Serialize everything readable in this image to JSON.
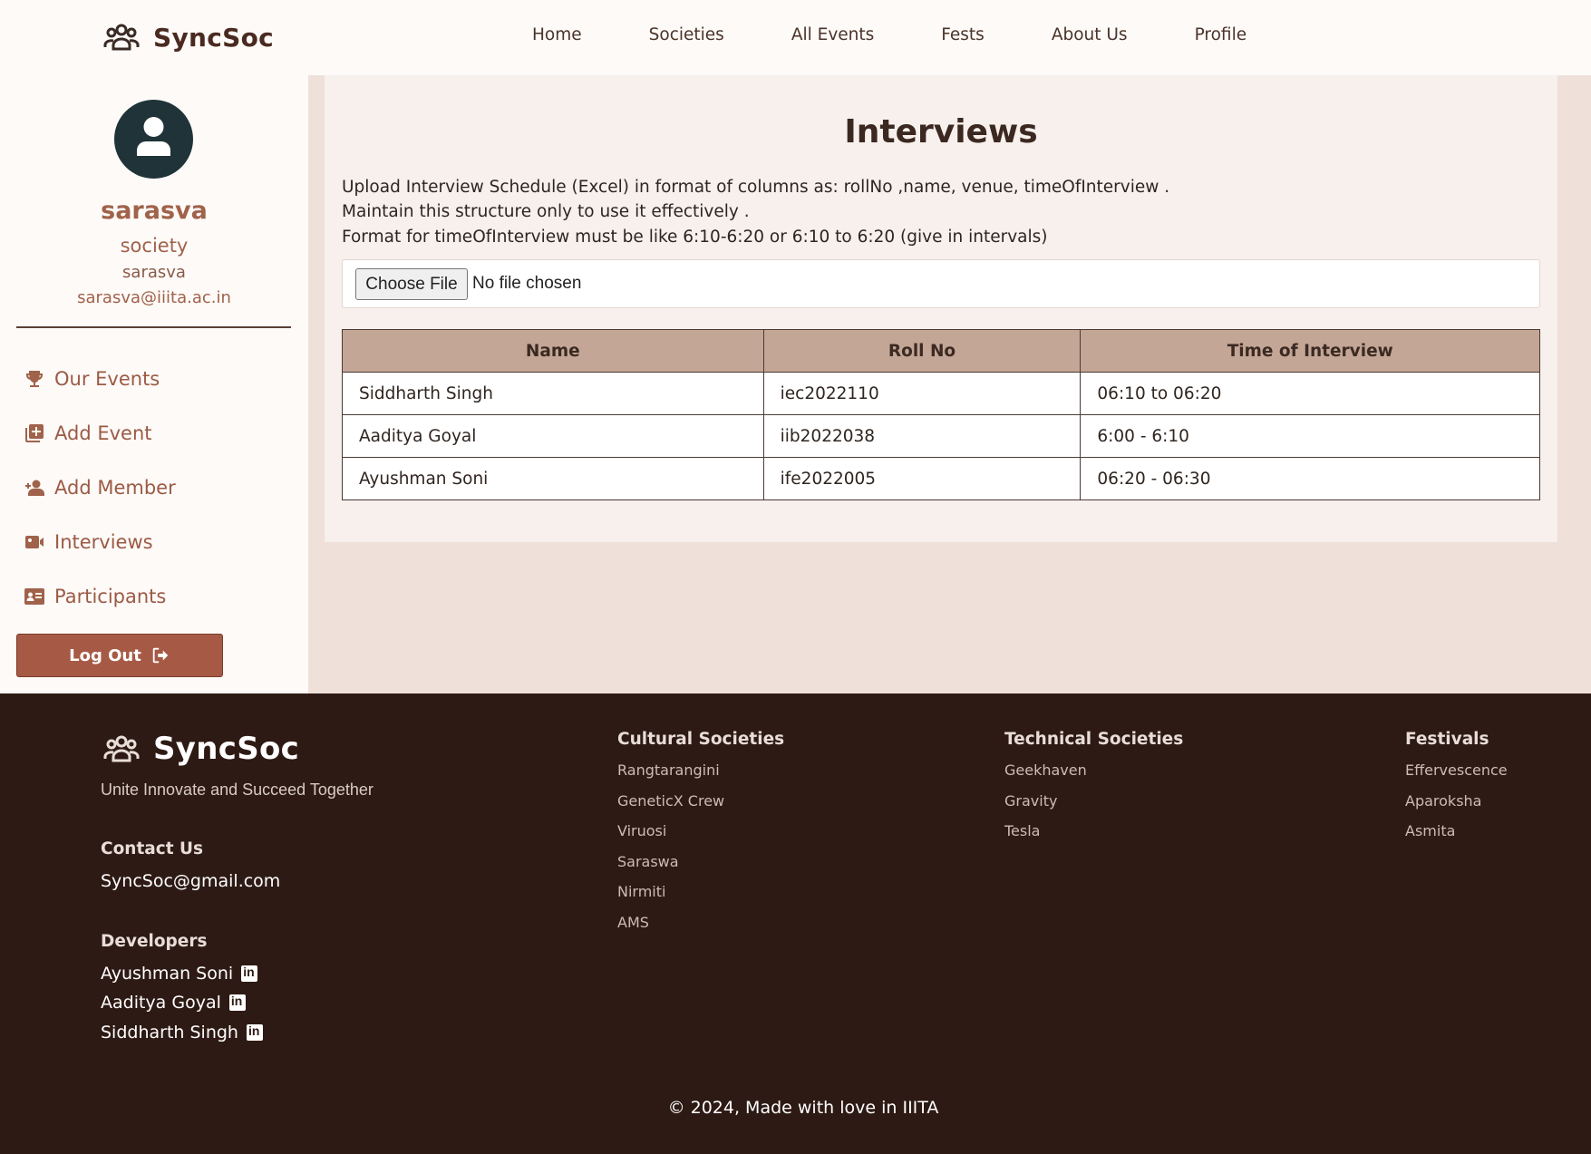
{
  "header": {
    "brand": "SyncSoc",
    "nav": [
      "Home",
      "Societies",
      "All Events",
      "Fests",
      "About Us",
      "Profile"
    ]
  },
  "sidebar": {
    "name": "sarasva",
    "role": "society",
    "handle": "sarasva",
    "email": "sarasva@iiita.ac.in",
    "menu": [
      {
        "label": "Our Events",
        "icon": "trophy-icon"
      },
      {
        "label": "Add Event",
        "icon": "add-box-icon"
      },
      {
        "label": "Add Member",
        "icon": "add-user-icon"
      },
      {
        "label": "Interviews",
        "icon": "video-camera-icon"
      },
      {
        "label": "Participants",
        "icon": "id-card-icon"
      }
    ],
    "logout": "Log Out"
  },
  "main": {
    "title": "Interviews",
    "instructions": [
      "Upload Interview Schedule (Excel) in format of columns as: rollNo ,name, venue, timeOfInterview .",
      "Maintain this structure only to use it effectively .",
      "Format for timeOfInterview must be like 6:10-6:20 or 6:10 to 6:20 (give in intervals)"
    ],
    "file_button": "Choose File",
    "file_status": "No file chosen",
    "table": {
      "headers": [
        "Name",
        "Roll No",
        "Time of Interview"
      ],
      "rows": [
        [
          "Siddharth Singh",
          "iec2022110",
          "06:10 to 06:20"
        ],
        [
          "Aaditya Goyal",
          "iib2022038",
          "6:00 - 6:10"
        ],
        [
          "Ayushman Soni",
          "ife2022005",
          "06:20 - 06:30"
        ]
      ]
    }
  },
  "footer": {
    "brand": "SyncSoc",
    "tagline": "Unite Innovate and Succeed Together",
    "contact_heading": "Contact Us",
    "contact_email": "SyncSoc@gmail.com",
    "developers_heading": "Developers",
    "developers": [
      "Ayushman Soni",
      "Aaditya Goyal",
      "Siddharth Singh"
    ],
    "columns": [
      {
        "heading": "Cultural Societies",
        "links": [
          "Rangtarangini",
          "GeneticX Crew",
          "Viruosi",
          "Saraswa",
          "Nirmiti",
          "AMS"
        ]
      },
      {
        "heading": "Technical Societies",
        "links": [
          "Geekhaven",
          "Gravity",
          "Tesla"
        ]
      },
      {
        "heading": "Festivals",
        "links": [
          "Effervescence",
          "Aparoksha",
          "Asmita"
        ]
      }
    ],
    "copyright": "© 2024, Made with love in IIITA"
  },
  "colors": {
    "accent": "#a0624a",
    "footer_bg": "#2e1a14",
    "table_header": "#c4a696",
    "page_bg": "#f0e0da"
  }
}
